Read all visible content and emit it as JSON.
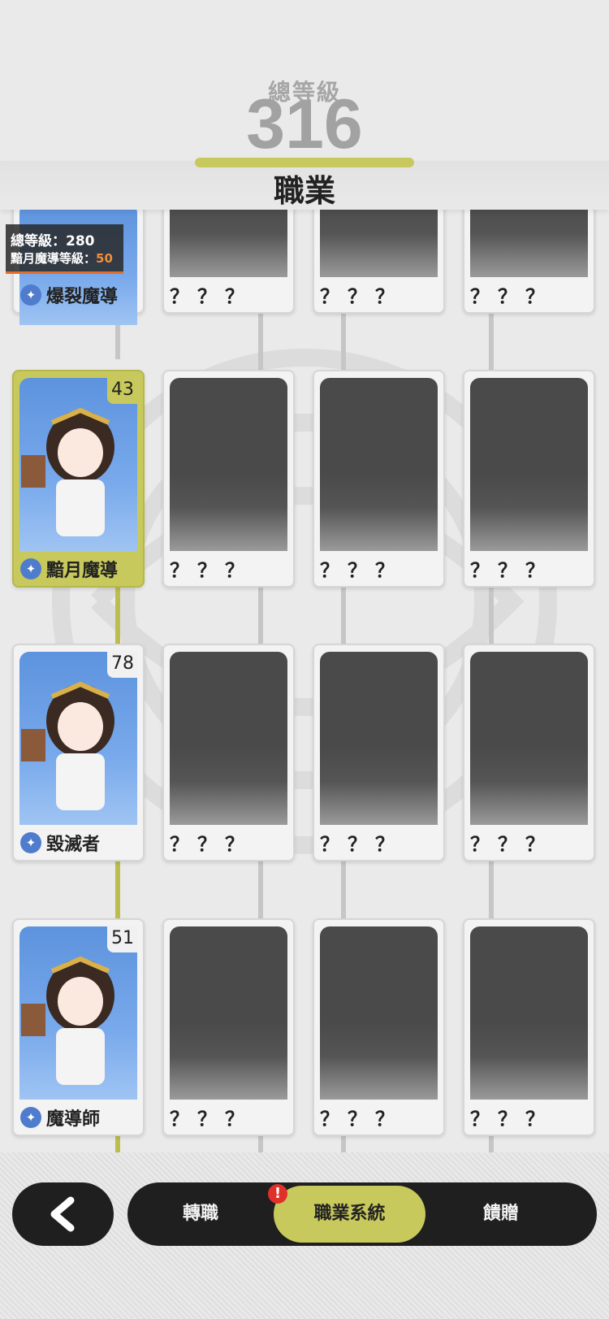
{
  "header": {
    "total_level_label": "總等級",
    "total_level_value": "316",
    "title": "職業"
  },
  "top_row": {
    "info_total_label": "總等級：",
    "info_total_value": "280",
    "info_job_label": "黯月魔導等級：",
    "info_job_value": "50",
    "job_name": "爆裂魔導",
    "locked": "？？？"
  },
  "rows": [
    {
      "name": "黯月魔導",
      "level": "43",
      "active": true
    },
    {
      "name": "毀滅者",
      "level": "78",
      "active": false
    },
    {
      "name": "魔導師",
      "level": "51",
      "active": false
    }
  ],
  "locked_label": "？？？",
  "icons": {
    "job_icon": "magic-class-icon",
    "back": "chevron-left-icon"
  },
  "nav": {
    "tabs": [
      "轉職",
      "職業系統",
      "饋贈"
    ],
    "active_index": 1,
    "notification": "!"
  },
  "colors": {
    "accent": "#c8c95c",
    "job_icon": "#4f7ccc",
    "alert": "#e0302a",
    "info_highlight": "#f08d3a"
  }
}
